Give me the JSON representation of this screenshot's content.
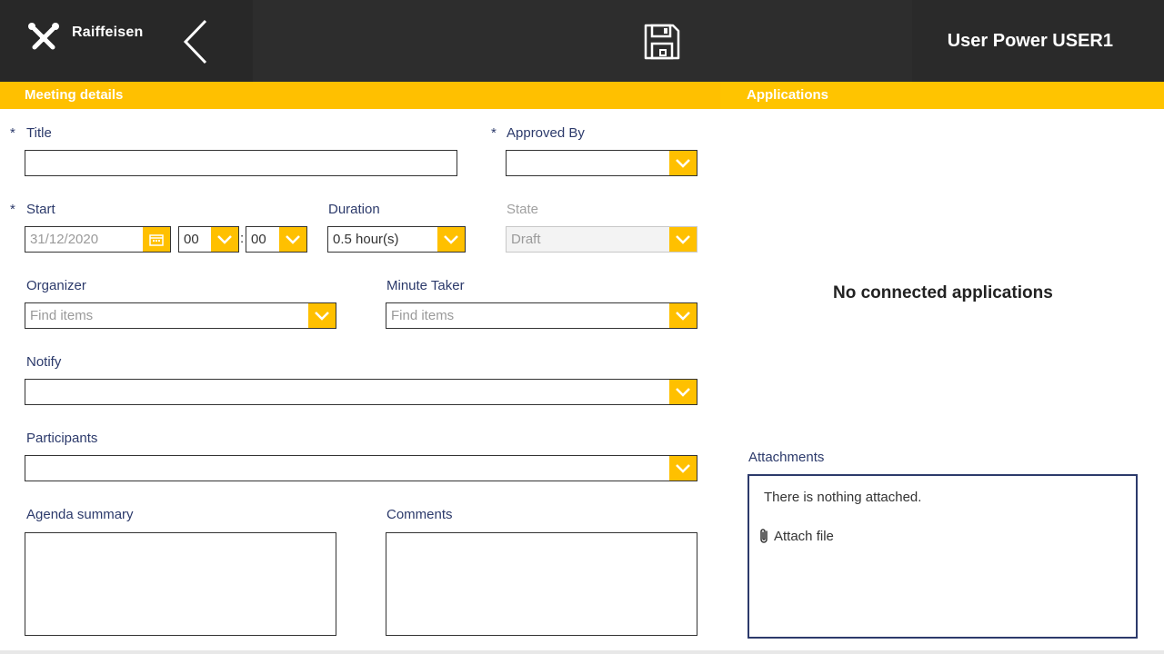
{
  "header": {
    "logo_text": "Raiffeisen",
    "user_name": "User Power USER1"
  },
  "sections": {
    "meeting_details": "Meeting details",
    "applications": "Applications"
  },
  "form": {
    "title": {
      "label": "Title",
      "required_mark": "*",
      "value": ""
    },
    "approved_by": {
      "label": "Approved By",
      "required_mark": "*",
      "value": ""
    },
    "start": {
      "label": "Start",
      "required_mark": "*",
      "date": "31/12/2020",
      "hour": "00",
      "minute": "00",
      "separator": ":"
    },
    "duration": {
      "label": "Duration",
      "value": "0.5 hour(s)"
    },
    "state": {
      "label": "State",
      "value": "Draft"
    },
    "organizer": {
      "label": "Organizer",
      "placeholder": "Find items"
    },
    "minute_taker": {
      "label": "Minute Taker",
      "placeholder": "Find items"
    },
    "notify": {
      "label": "Notify",
      "value": ""
    },
    "participants": {
      "label": "Participants",
      "value": ""
    },
    "agenda_summary": {
      "label": "Agenda summary"
    },
    "comments": {
      "label": "Comments"
    }
  },
  "applications": {
    "empty_text": "No connected applications"
  },
  "attachments": {
    "label": "Attachments",
    "empty_text": "There is nothing attached.",
    "attach_label": "Attach file"
  },
  "colors": {
    "accent": "#ffc000",
    "header_bg": "#2d2d2d",
    "label_text": "#2c3a6b"
  }
}
